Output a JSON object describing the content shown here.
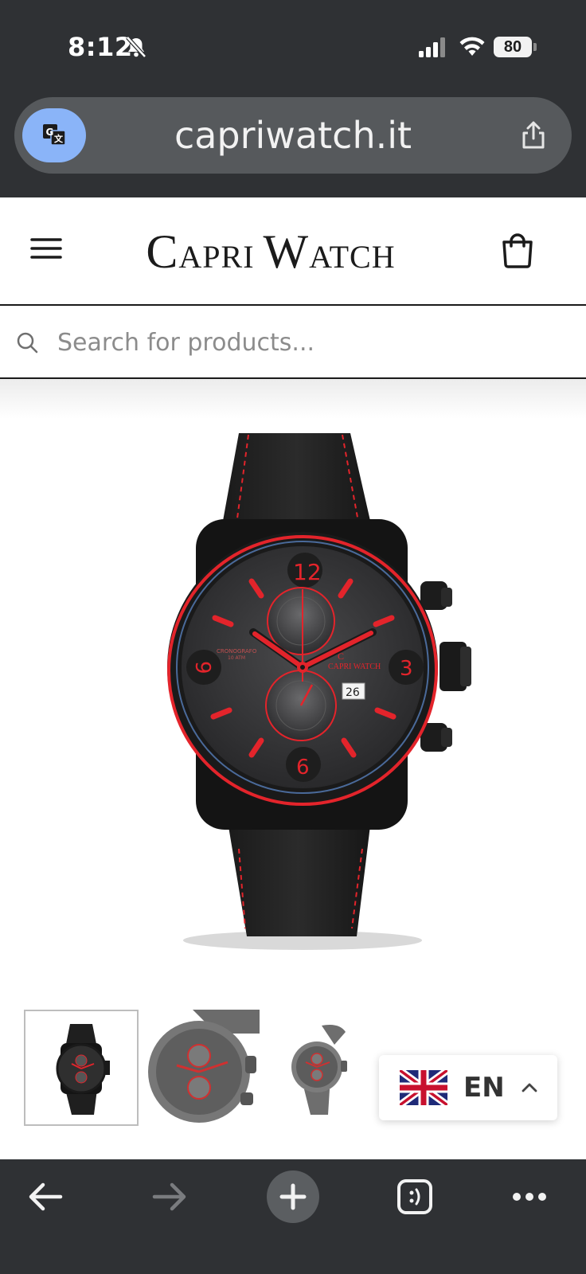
{
  "status_bar": {
    "time": "8:12",
    "battery": "80",
    "icons": [
      "bell-slash-icon",
      "signal-icon",
      "wifi-icon",
      "battery-icon"
    ]
  },
  "browser": {
    "url": "capriwatch.it",
    "icons": [
      "translate-icon",
      "share-icon"
    ],
    "accent_color": "#8ab4f8",
    "chrome_color": "#2f3134"
  },
  "header": {
    "logo_first": "C",
    "logo_first_rest": "APRI",
    "logo_second": "W",
    "logo_second_rest": "ATCH",
    "icons": [
      "menu-icon",
      "cart-icon"
    ]
  },
  "search": {
    "placeholder": "Search for products..."
  },
  "product": {
    "dial_numbers": [
      "12",
      "3",
      "6",
      "9"
    ],
    "date": "26",
    "brand_on_dial": "CAPRI WATCH",
    "accent_color": "#e3242b"
  },
  "thumbnails": [
    "thumbnail-1",
    "thumbnail-2",
    "thumbnail-3"
  ],
  "language": {
    "code": "EN",
    "icons": [
      "uk-flag-icon",
      "chevron-up-icon"
    ]
  },
  "toolbar": {
    "icons": [
      "back-arrow-icon",
      "forward-arrow-icon",
      "new-tab-icon",
      "tabs-icon",
      "more-icon"
    ]
  }
}
